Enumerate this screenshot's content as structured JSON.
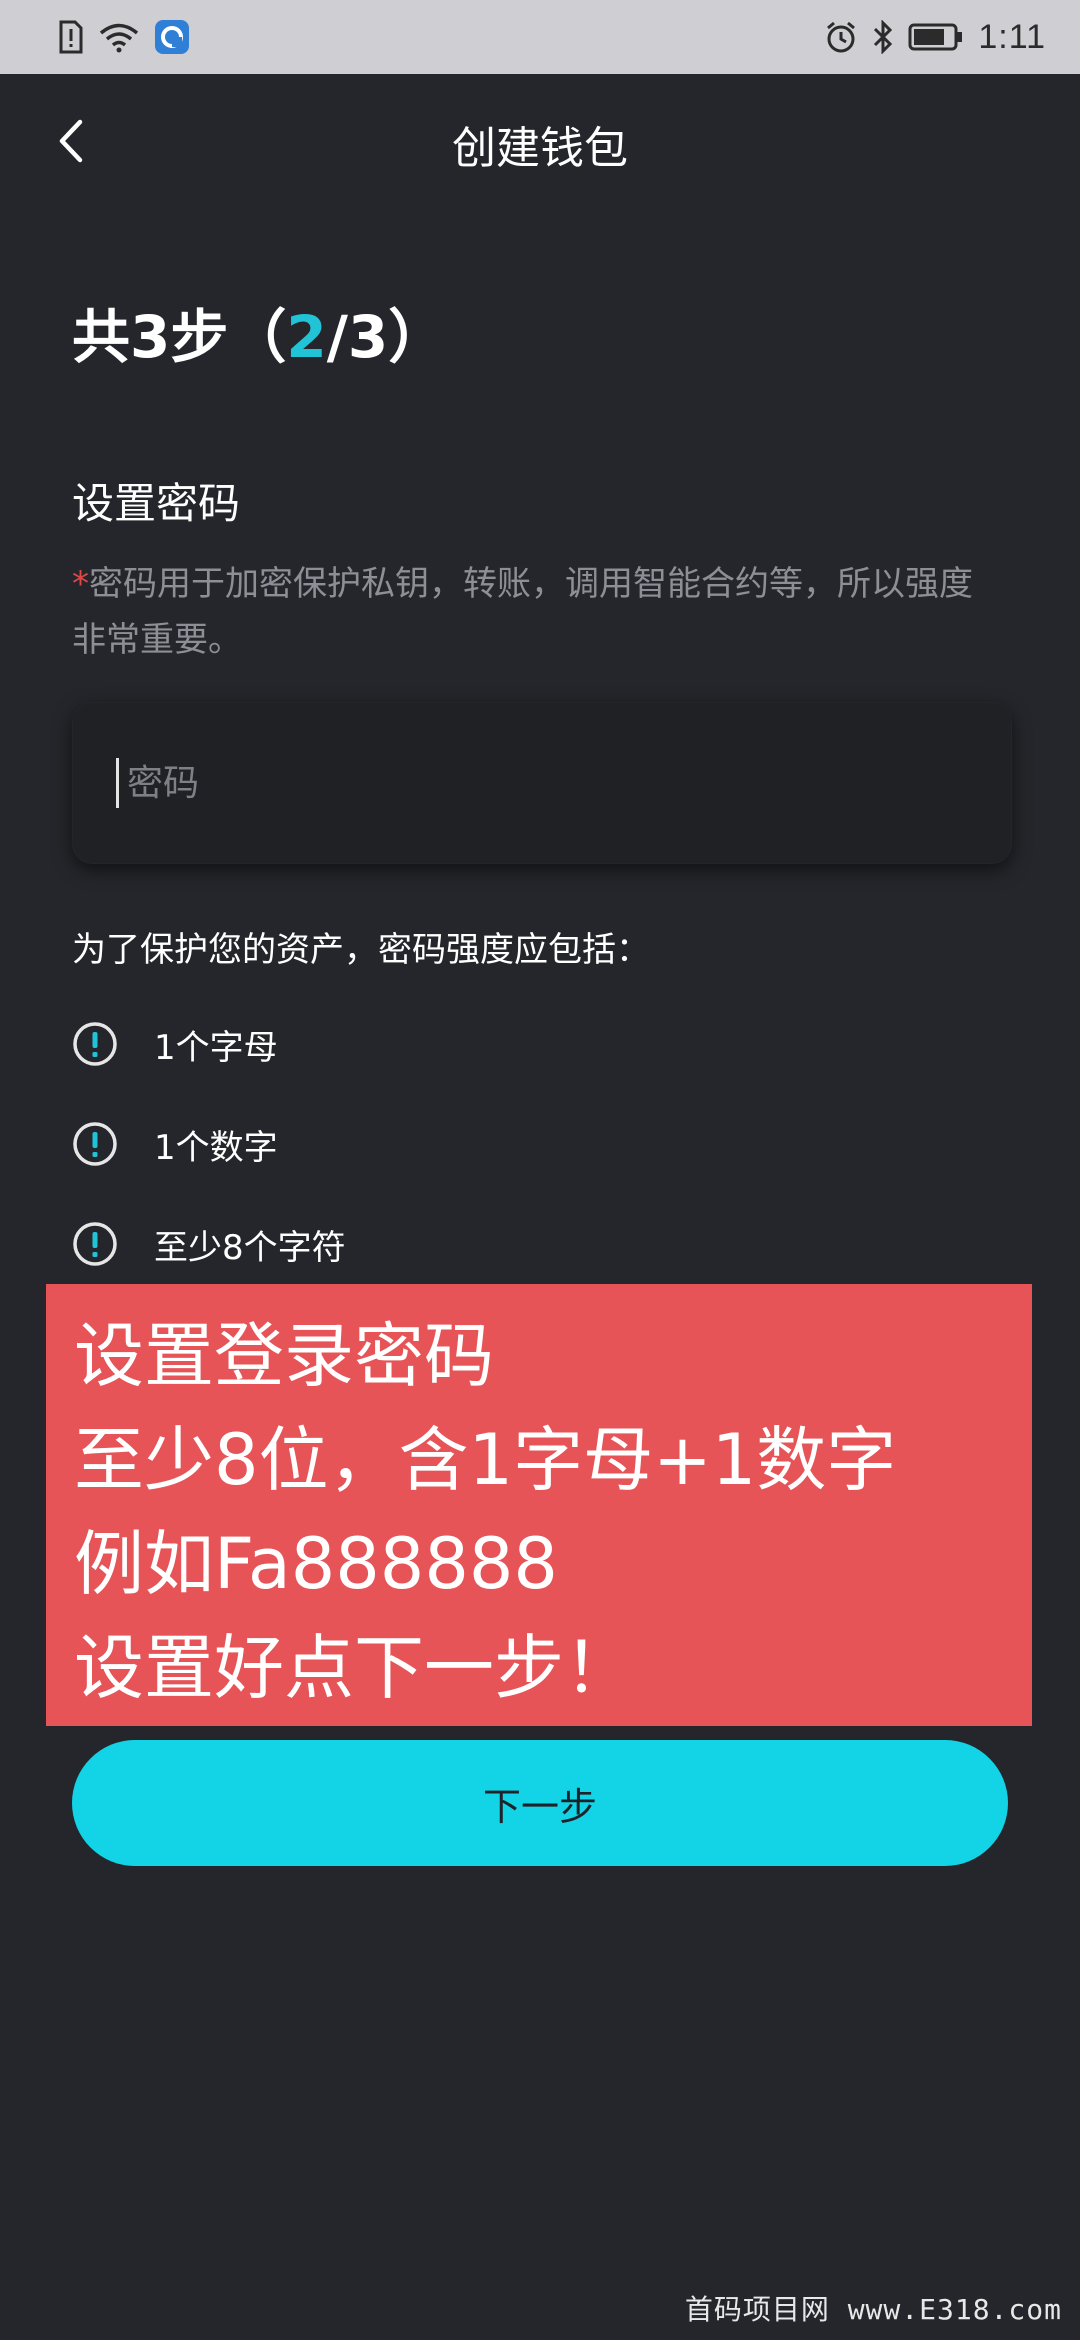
{
  "status_bar": {
    "time": "1:11",
    "icons": [
      "sim-alert-icon",
      "wifi-icon",
      "app-notification-icon",
      "alarm-icon",
      "bluetooth-icon",
      "battery-icon"
    ]
  },
  "header": {
    "title": "创建钱包",
    "back_icon": "chevron-left-icon"
  },
  "step": {
    "prefix": "共3步（",
    "current": "2",
    "suffix": "/3）"
  },
  "section": {
    "title": "设置密码",
    "asterisk": "*",
    "description": "密码用于加密保护私钥，转账，调用智能合约等，所以强度非常重要。"
  },
  "password_input": {
    "placeholder": "密码",
    "value": ""
  },
  "rules": {
    "intro": "为了保护您的资产，密码强度应包括：",
    "items": [
      {
        "label": "1个字母",
        "icon": "exclamation-circle-icon"
      },
      {
        "label": "1个数字",
        "icon": "exclamation-circle-icon"
      },
      {
        "label": "至少8个字符",
        "icon": "exclamation-circle-icon"
      }
    ]
  },
  "overlay_note": {
    "lines": [
      "设置登录密码",
      "至少8位，含1字母+1数字",
      "例如Fa888888",
      "设置好点下一步！"
    ],
    "color": "#e65457"
  },
  "next_button": {
    "label": "下一步",
    "color": "#12d4e6"
  },
  "watermark": "首码项目网 www.E318.com",
  "colors": {
    "background": "#25262b",
    "accent": "#21c4d6",
    "asterisk": "#e04848"
  }
}
